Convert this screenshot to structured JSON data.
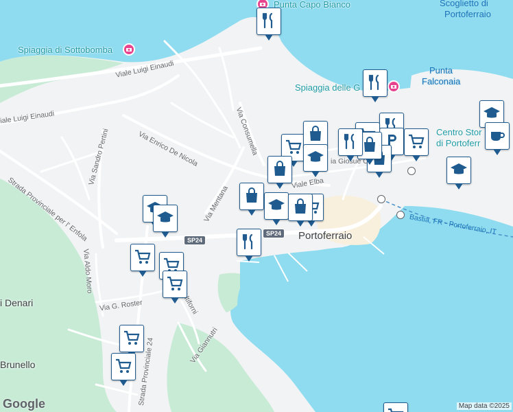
{
  "map": {
    "water_labels": [
      {
        "id": "scoglietto-label-1",
        "text": "Scoglietto di"
      },
      {
        "id": "scoglietto-label-2",
        "text": "Portoferraio"
      },
      {
        "id": "punta-falconaia-label-1",
        "text": "Punta"
      },
      {
        "id": "punta-falconaia-label-2",
        "text": "Falconaia"
      }
    ],
    "poi_labels": [
      {
        "id": "punta-capo-bianco-label",
        "text": "Punta Capo Bianco"
      },
      {
        "id": "spiaggia-sottobomba-label",
        "text": "Spiaggia di Sottobomba"
      },
      {
        "id": "spiaggia-ghiaie-label",
        "text": "Spiaggia delle G"
      },
      {
        "id": "centro-storico-label-1",
        "text": "Centro Stor"
      },
      {
        "id": "centro-storico-label-2",
        "text": "di Portoferr"
      }
    ],
    "town_label": "Portoferraio",
    "place_labels": [
      {
        "id": "denari-label",
        "text": "i Denari"
      },
      {
        "id": "brunello-label",
        "text": "Brunello"
      }
    ],
    "road_labels": [
      {
        "id": "road-luigi-einaudi-1",
        "text": "Viale Luigi Einaudi"
      },
      {
        "id": "road-luigi-einaudi-2",
        "text": "iale Luigi Einaudi"
      },
      {
        "id": "road-enrico-de-nicola",
        "text": "Via Enrico De Nicola"
      },
      {
        "id": "road-consumella",
        "text": "Via Consumella"
      },
      {
        "id": "road-sandro-pertini",
        "text": "Via Sandro Pertini"
      },
      {
        "id": "road-enfola",
        "text": "Strada Provinciale per l' Enfola"
      },
      {
        "id": "road-mentana",
        "text": "Via Mentana"
      },
      {
        "id": "road-viale-elba",
        "text": "Viale Elba"
      },
      {
        "id": "road-giosue",
        "text": "ia Giosuè C"
      },
      {
        "id": "road-aldo-moro",
        "text": "Via Aldo Moro"
      },
      {
        "id": "road-roster",
        "text": "Via G. Roster"
      },
      {
        "id": "road-altiforni",
        "text": "Altiforni"
      },
      {
        "id": "road-giannutri",
        "text": "Via Giannutri"
      },
      {
        "id": "road-sp24",
        "text": "Strada Provinciale 24"
      }
    ],
    "road_shields": [
      {
        "id": "sp24-shield-1",
        "text": "SP24"
      },
      {
        "id": "sp24-shield-2",
        "text": "SP24"
      }
    ],
    "ferry_label": "Bastia, FR - Portoferraio, IT",
    "logo": "Google",
    "attribution": "Map data ©2025"
  },
  "colors": {
    "water": "#8fdcf0",
    "land": "#f1f3f4",
    "park": "#c8ebd6",
    "road": "#ffffff",
    "urban": "#f8f0dc",
    "pin_border": "#1f5b8f",
    "poi_pink": "#e8438f"
  },
  "pins": [
    {
      "id": "pin-restaurant-capo-bianco",
      "type": "restaurant"
    },
    {
      "id": "pin-restaurant-ghiaie",
      "type": "restaurant"
    },
    {
      "id": "pin-school-east",
      "type": "school"
    },
    {
      "id": "pin-cafe-east",
      "type": "cafe"
    },
    {
      "id": "pin-school-far-east",
      "type": "school"
    },
    {
      "id": "pin-restaurant-center-1",
      "type": "restaurant"
    },
    {
      "id": "pin-parking-center",
      "type": "parking"
    },
    {
      "id": "pin-cart-center-1",
      "type": "cart"
    },
    {
      "id": "pin-shopping-center-1",
      "type": "shopping"
    },
    {
      "id": "pin-cart-center-2",
      "type": "cart"
    },
    {
      "id": "pin-shopping-center-2",
      "type": "shopping"
    },
    {
      "id": "pin-restaurant-center-2",
      "type": "restaurant"
    },
    {
      "id": "pin-cart-center-3",
      "type": "cart"
    },
    {
      "id": "pin-shopping-center-3",
      "type": "shopping"
    },
    {
      "id": "pin-school-center",
      "type": "school"
    },
    {
      "id": "pin-shopping-center-4",
      "type": "shopping"
    },
    {
      "id": "pin-shopping-center-5",
      "type": "shopping"
    },
    {
      "id": "pin-school-viale-elba",
      "type": "school"
    },
    {
      "id": "pin-cart-viale-elba",
      "type": "cart"
    },
    {
      "id": "pin-shopping-viale-elba",
      "type": "shopping"
    },
    {
      "id": "pin-restaurant-harbor",
      "type": "restaurant"
    },
    {
      "id": "pin-school-west-1",
      "type": "school"
    },
    {
      "id": "pin-school-west-2",
      "type": "school"
    },
    {
      "id": "pin-cart-west-1",
      "type": "cart"
    },
    {
      "id": "pin-cart-west-2",
      "type": "cart"
    },
    {
      "id": "pin-cart-west-3",
      "type": "cart"
    },
    {
      "id": "pin-cart-south-1",
      "type": "cart"
    },
    {
      "id": "pin-cart-south-2",
      "type": "cart"
    },
    {
      "id": "pin-cart-bottom-right",
      "type": "cart"
    }
  ]
}
